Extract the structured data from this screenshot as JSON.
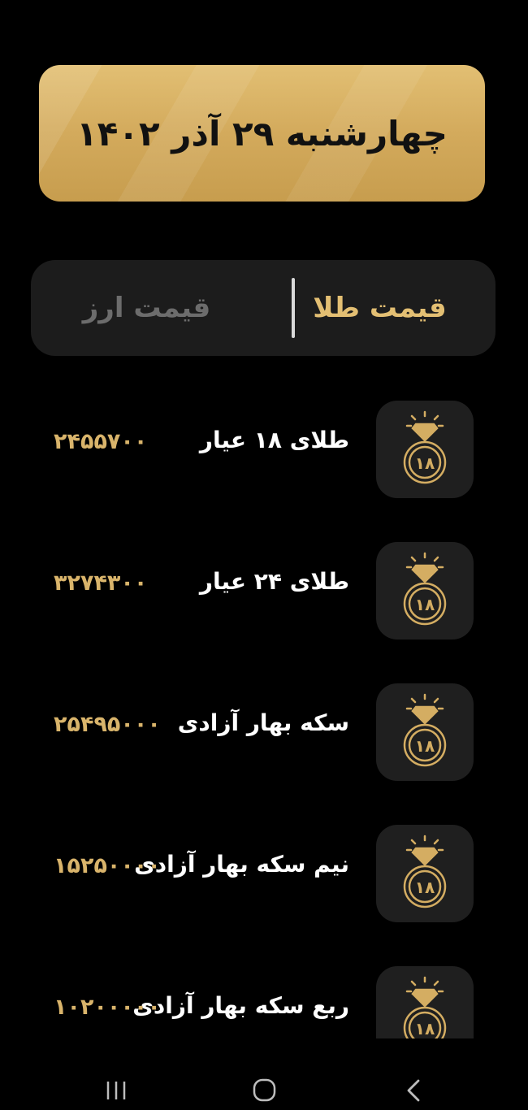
{
  "header": {
    "date_text": "چهارشنبه ۲۹ آذر ۱۴۰۲"
  },
  "tabs": [
    {
      "label": "قیمت طلا",
      "active": true
    },
    {
      "label": "قیمت ارز",
      "active": false
    }
  ],
  "items": [
    {
      "name": "طلای ۱۸ عیار",
      "price": "۲۴۵۵۷۰۰",
      "icon": "ring-18-icon",
      "badge": "۱۸"
    },
    {
      "name": "طلای ۲۴ عیار",
      "price": "۳۲۷۴۳۰۰",
      "icon": "ring-18-icon",
      "badge": "۱۸"
    },
    {
      "name": "سکه بهار آزادی",
      "price": "۲۵۴۹۵۰۰۰",
      "icon": "ring-18-icon",
      "badge": "۱۸"
    },
    {
      "name": "نیم سکه بهار آزادی",
      "price": "۱۵۲۵۰۰۰۰",
      "icon": "ring-18-icon",
      "badge": "۱۸"
    },
    {
      "name": "ربع سکه بهار آزادی",
      "price": "۱۰۲۰۰۰۰۰",
      "icon": "ring-18-icon",
      "badge": "۱۸"
    }
  ],
  "colors": {
    "background": "#000000",
    "gold_accent": "#e3bf73",
    "price_text": "#d9b46b",
    "card_background": "#1c1c1c",
    "inactive_tab_text": "#6c6c6c"
  },
  "navigation": {
    "buttons": [
      "recent-apps-icon",
      "home-icon",
      "back-icon"
    ]
  }
}
